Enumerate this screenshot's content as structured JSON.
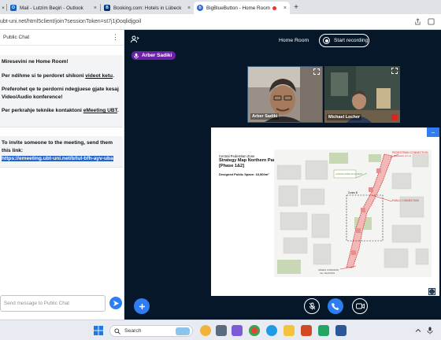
{
  "browser": {
    "tabs": [
      {
        "label": "Mail - Lutzim Beqiri - Outlook",
        "icon": "outlook-icon",
        "color": "#0a64c8"
      },
      {
        "label": "Booking.com: Hotels in Lübeck",
        "icon": "booking-icon",
        "color": "#003580"
      },
      {
        "label": "BigBlueButton - Home Room",
        "icon": "bbb-icon",
        "color": "#2e6bd9",
        "active": true
      }
    ],
    "close_glyph": "×",
    "new_tab_glyph": "+",
    "url": "ubt-uni.net/html5client/join?sessionToken=st7j1j0oqlidjgoil"
  },
  "chat": {
    "title": "Public Chat",
    "welcome": {
      "line1_prefix": "Miresevini ne ",
      "line1_room": "Home Room",
      "line1_suffix": "!",
      "line2_prefix": "Per ndihme si te perdoret shikoni ",
      "line2_link": "videot ketu",
      "line2_suffix": ".",
      "line3": "Preferohet qe te perdorni ndegjuese gjate kesaj Video/Audio konference!",
      "line4_prefix": "Per perkrahje teknike kontaktoni ",
      "line4_link": "eMeeting UBT",
      "line4_suffix": "."
    },
    "invite": {
      "text": "To invite someone to the meeting, send them this link:",
      "link": "https://emeeting.ubt-uni.net/b/lul-bfh-ayv-uba"
    },
    "input_placeholder": "Send message to Public Chat"
  },
  "meeting": {
    "room_name": "Home Room",
    "record_label": "Start recording",
    "talking_indicator": "Arber Sadiki",
    "videos": [
      {
        "name": "Arber Sadiki"
      },
      {
        "name": "Michael Locher"
      }
    ]
  },
  "presentation": {
    "subtitle": "Central Pedestrian Zone",
    "title_line1": "Strategy Map Northern Part",
    "title_line2": "[Phase 1&2]",
    "designed_space": "Designed Public Space: 18,500m²",
    "labels": {
      "pedestrian": "PEDESTRIAN CONNECTION",
      "pedestrian_sub": "(Extension of 1.1)",
      "landscaped": "LANDSCAPED ADJACENT",
      "zones": "Zones B",
      "public_connection": "PUBLIC CONNECTION",
      "green": "GREEN CORRIDOR",
      "green_sub": "ALL SEASONS"
    }
  },
  "taskbar": {
    "search_label": "Search"
  },
  "colors": {
    "meeting_bg": "#06172a",
    "accent_blue": "#2e7df2",
    "talker_purple": "#6b21a8",
    "map_red": "#d62828"
  }
}
